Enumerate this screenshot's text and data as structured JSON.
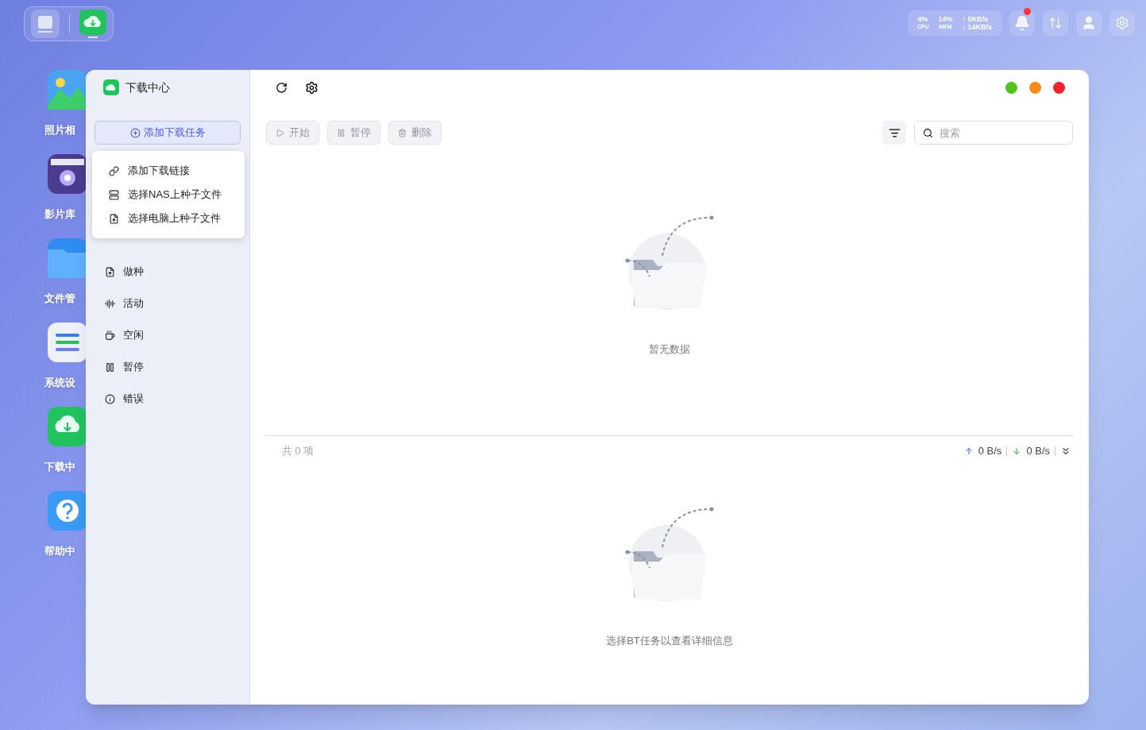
{
  "status": {
    "cpu": "4%",
    "cpu_label": "CPU",
    "mem": "14%",
    "mem_label": "MEM",
    "up": "↑ 5KB/s",
    "down": "↓ 14KB/s"
  },
  "notifications": {
    "unread": true
  },
  "desktop_icons": [
    {
      "kind": "photos",
      "label": "照片相"
    },
    {
      "kind": "video",
      "label": "影片库"
    },
    {
      "kind": "files",
      "label": "文件管"
    },
    {
      "kind": "settings",
      "label": "系统设"
    },
    {
      "kind": "download",
      "label": "下载中"
    },
    {
      "kind": "help",
      "label": "帮助中"
    }
  ],
  "window": {
    "title": "下载中心",
    "add_button": "添加下载任务",
    "add_menu": [
      {
        "kind": "link",
        "label": "添加下载链接"
      },
      {
        "kind": "nas",
        "label": "选择NAS上种子文件"
      },
      {
        "kind": "pc",
        "label": "选择电脑上种子文件"
      }
    ],
    "filters": [
      {
        "kind": "seed",
        "label": "做种"
      },
      {
        "kind": "active",
        "label": "活动"
      },
      {
        "kind": "idle",
        "label": "空闲"
      },
      {
        "kind": "paused",
        "label": "暂停"
      },
      {
        "kind": "error",
        "label": "错误"
      }
    ],
    "controls": [
      {
        "color": "#52c41a"
      },
      {
        "color": "#fa8c16"
      },
      {
        "color": "#f5222d"
      }
    ],
    "toolbar": [
      {
        "kind": "play",
        "label": "开始",
        "disabled": true
      },
      {
        "kind": "pause",
        "label": "暂停",
        "disabled": true
      },
      {
        "kind": "delete",
        "label": "删除",
        "disabled": true
      }
    ],
    "search": {
      "placeholder": "搜索"
    },
    "list": {
      "empty_text": "暂无数据"
    },
    "footer": {
      "count": "共 0 项",
      "upload": "0 B/s",
      "download": "0 B/s"
    },
    "details": {
      "empty_text": "选择BT任务以查看详细信息"
    }
  }
}
